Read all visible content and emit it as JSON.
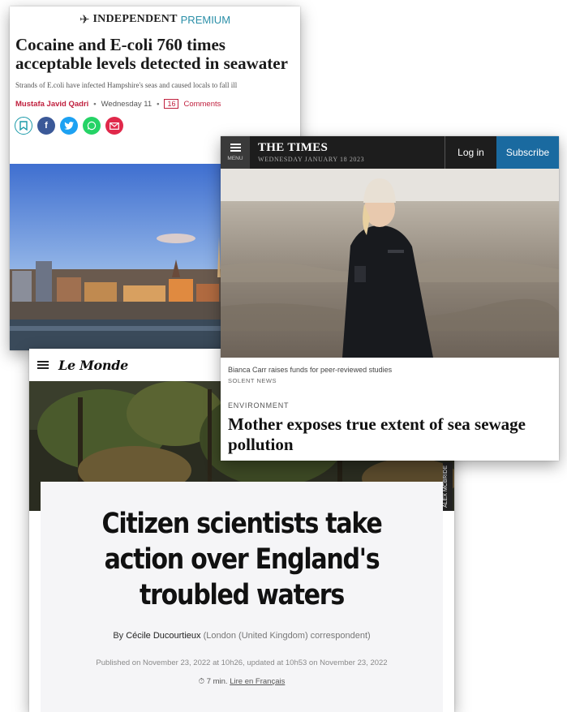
{
  "independent": {
    "brand": "INDEPENDENT",
    "premium": "PREMIUM",
    "headline": "Cocaine and E-coli 760 times acceptable levels detected in seawater",
    "standfirst": "Strands of E.coli have infected Hampshire's seas and caused locals to fall ill",
    "author": "Mustafa Javid Qadri",
    "date": "Wednesday 11",
    "comments_count": "16",
    "comments_label": "Comments",
    "share_icons": [
      "bookmark-icon",
      "facebook-icon",
      "twitter-icon",
      "whatsapp-icon",
      "email-icon"
    ]
  },
  "times": {
    "menu_label": "MENU",
    "logo": "THE TIMES",
    "date": "WEDNESDAY JANUARY 18 2023",
    "login": "Log in",
    "subscribe": "Subscribe",
    "caption": "Bianca Carr raises funds for peer-reviewed studies",
    "source": "SOLENT NEWS",
    "section": "ENVIRONMENT",
    "headline": "Mother exposes true extent of sea sewage pollution"
  },
  "lemonde": {
    "logo": "Le Monde",
    "photo_credit": "ALEX MCBRIDE",
    "title": "Citizen scientists take action over England's troubled waters",
    "by": "By",
    "author": "Cécile Ducourtieux",
    "author_role": "(London (United Kingdom) correspondent)",
    "published": "Published on November 23, 2022 at 10h26, updated at 10h53 on November 23, 2022",
    "read_time": "7 min.",
    "read_french": "Lire en Français"
  },
  "colors": {
    "independent_accent": "#c0203e",
    "independent_premium": "#2b8fa8",
    "times_subscribe": "#1a6aa0",
    "times_bar": "#1d1d1d"
  }
}
